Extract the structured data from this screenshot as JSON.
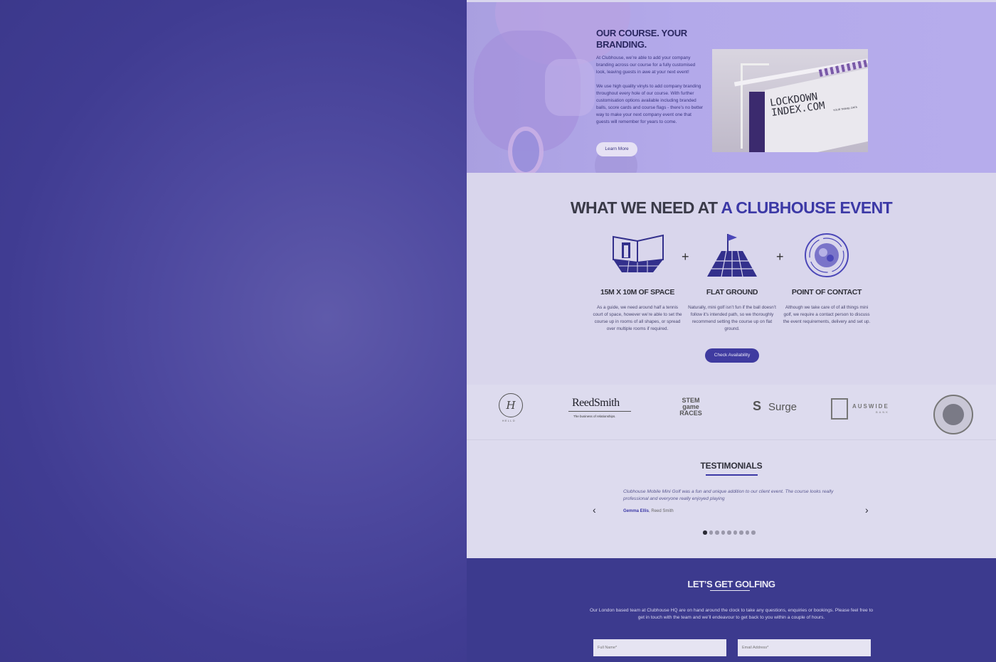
{
  "branding": {
    "title": "OUR COURSE. YOUR BRANDING.",
    "paragraph1": "At Clubhouse, we’re able to add your company branding across our course for a fully customised look, leaving guests in awe at your next event!",
    "paragraph2": "We use high quality vinyls to add company branding throughout every hole of our course. With further customisation options available including branded balls, score cards and course flags - there’s no better way to make your next company event one that guests will remember for years to come.",
    "learn_more": "Learn More",
    "photo_sign": "LOCKDOWN\nINDEX.COM",
    "photo_sign_small": "YOUR TRAVEL DATA"
  },
  "needs": {
    "title_part1": "WHAT WE NEED AT",
    "title_part2": "A CLUBHOUSE EVENT",
    "items": [
      {
        "heading": "15M X 10M OF SPACE",
        "text": "As a guide, we need around half a tennis court of space, however we’re able to set the course up in rooms of all shapes, or spread over multiple rooms if required.",
        "icon": "room-icon"
      },
      {
        "heading": "FLAT GROUND",
        "text": "Naturally, mini golf isn’t fun if the ball doesn’t follow it’s intended path, so we thoroughly recommend setting the course up on flat ground.",
        "icon": "flat-ground-icon"
      },
      {
        "heading": "POINT OF CONTACT",
        "text": "Although we take care of of all things mini golf, we require a contact person to discuss the event requirements, delivery and set up.",
        "icon": "contact-icon"
      }
    ],
    "plus": "+",
    "button": "Check Availability"
  },
  "logos": {
    "hello": "H",
    "hello_sub": "HELLO",
    "reed": "ReedSmith",
    "reed_sub": "The business of relationships.",
    "stem": "STEM\ngame\nRACES",
    "surge": "Surge",
    "auswide": "AUSWIDE",
    "auswide_sub": "BANK"
  },
  "testimonials": {
    "title": "TESTIMONIALS",
    "quote": "Clubhouse Mobile Mini Golf was a fun and unique addition to our client event. The course looks really professional and everyone really enjoyed playing",
    "author": "Gemma Ellis",
    "company": ", Reed Smith",
    "prev": "‹",
    "next": "›",
    "dot_count": 9,
    "active_dot": 0
  },
  "contact": {
    "title": "LET’S GET GOLFING",
    "text": "Our London based team at Clubhouse HQ are on hand around the clock to take any questions, enquiries or bookings. Please feel free to get in touch with the team and we’ll endeavour to get back to you within a couple of hours.",
    "name_placeholder": "Full Name*",
    "email_placeholder": "Email Address*"
  },
  "colors": {
    "accent": "#3c39a6",
    "backdrop": "#3d3a8e",
    "branding_bg": "#b3a9ea",
    "section_bg": "#d9d6ec"
  }
}
